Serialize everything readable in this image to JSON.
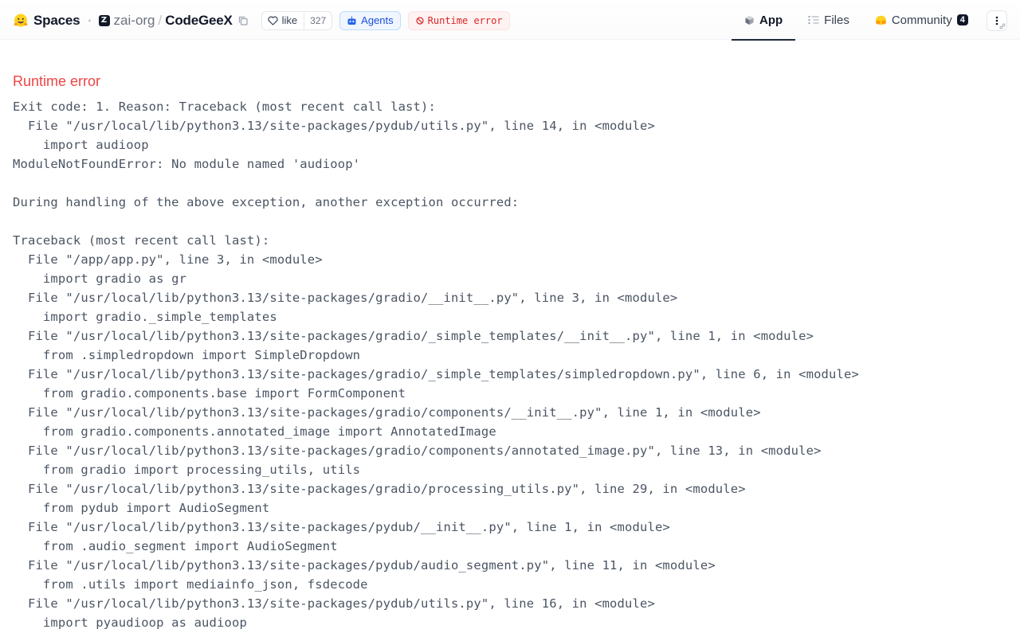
{
  "header": {
    "spaces_label": "Spaces",
    "org_name": "zai-org",
    "org_icon_letter": "Z",
    "separator": "/",
    "repo_name": "CodeGeeX",
    "like_label": "like",
    "like_count": "327",
    "agents_label": "Agents",
    "status_label": "Runtime error",
    "status_color": "#dc2626",
    "accent_color": "#1d4ed8"
  },
  "tabs": [
    {
      "label": "App",
      "icon": "cube-icon",
      "active": true
    },
    {
      "label": "Files",
      "icon": "files-icon",
      "active": false
    },
    {
      "label": "Community",
      "icon": "community-icon",
      "active": false,
      "badge": "4"
    }
  ],
  "main": {
    "error_title": "Runtime error",
    "traceback_lines": [
      "Exit code: 1. Reason: Traceback (most recent call last):",
      "  File \"/usr/local/lib/python3.13/site-packages/pydub/utils.py\", line 14, in <module>",
      "    import audioop",
      "ModuleNotFoundError: No module named 'audioop'",
      "",
      "During handling of the above exception, another exception occurred:",
      "",
      "Traceback (most recent call last):",
      "  File \"/app/app.py\", line 3, in <module>",
      "    import gradio as gr",
      "  File \"/usr/local/lib/python3.13/site-packages/gradio/__init__.py\", line 3, in <module>",
      "    import gradio._simple_templates",
      "  File \"/usr/local/lib/python3.13/site-packages/gradio/_simple_templates/__init__.py\", line 1, in <module>",
      "    from .simpledropdown import SimpleDropdown",
      "  File \"/usr/local/lib/python3.13/site-packages/gradio/_simple_templates/simpledropdown.py\", line 6, in <module>",
      "    from gradio.components.base import FormComponent",
      "  File \"/usr/local/lib/python3.13/site-packages/gradio/components/__init__.py\", line 1, in <module>",
      "    from gradio.components.annotated_image import AnnotatedImage",
      "  File \"/usr/local/lib/python3.13/site-packages/gradio/components/annotated_image.py\", line 13, in <module>",
      "    from gradio import processing_utils, utils",
      "  File \"/usr/local/lib/python3.13/site-packages/gradio/processing_utils.py\", line 29, in <module>",
      "    from pydub import AudioSegment",
      "  File \"/usr/local/lib/python3.13/site-packages/pydub/__init__.py\", line 1, in <module>",
      "    from .audio_segment import AudioSegment",
      "  File \"/usr/local/lib/python3.13/site-packages/pydub/audio_segment.py\", line 11, in <module>",
      "    from .utils import mediainfo_json, fsdecode",
      "  File \"/usr/local/lib/python3.13/site-packages/pydub/utils.py\", line 16, in <module>",
      "    import pyaudioop as audioop"
    ]
  }
}
